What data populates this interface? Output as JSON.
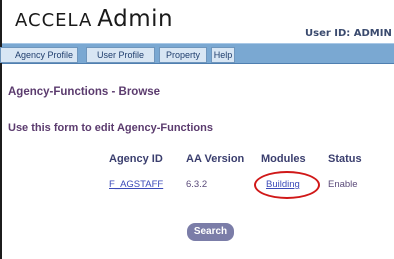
{
  "header": {
    "brand": "ACCELA",
    "app": "Admin",
    "user_id_label": "User ID: ADMIN"
  },
  "nav": {
    "tabs": [
      {
        "label": "Agency Profile"
      },
      {
        "label": "User Profile"
      },
      {
        "label": "Property"
      },
      {
        "label": "Help"
      }
    ]
  },
  "page": {
    "title": "Agency-Functions - Browse",
    "instructions": "Use this form to edit Agency-Functions"
  },
  "table": {
    "columns": [
      "Agency ID",
      "AA Version",
      "Modules",
      "Status"
    ],
    "rows": [
      {
        "agency_id": "F_AGSTAFF",
        "aa_version": "6.3.2",
        "modules": "Building",
        "status": "Enable"
      }
    ]
  },
  "actions": {
    "search_label": "Search"
  },
  "colors": {
    "nav_bar": "#7aa8d2",
    "title_text": "#5b3b6e",
    "link": "#3b4ab8",
    "highlight_ring": "#d01818",
    "search_button": "#7b7da8"
  }
}
